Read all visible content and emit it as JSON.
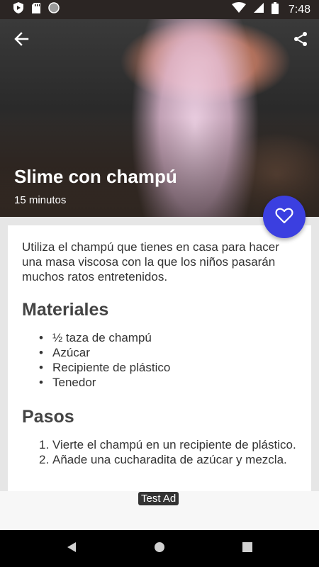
{
  "status_bar": {
    "time": "7:48",
    "icons": [
      "shield-icon",
      "sd-card-icon",
      "circle-icon",
      "wifi-icon",
      "signal-icon",
      "battery-icon"
    ]
  },
  "hero": {
    "title": "Slime con champú",
    "duration": "15 minutos",
    "back_icon": "arrow-back-icon",
    "share_icon": "share-icon"
  },
  "fab": {
    "icon": "heart-outline-icon",
    "color": "#3b3fe0"
  },
  "content": {
    "intro": "Utiliza el champú que tienes en casa para hacer una masa viscosa con la que los niños pasarán muchos ratos entretenidos.",
    "materials_title": "Materiales",
    "materials": [
      "½ taza de champú",
      "Azúcar",
      "Recipiente de plástico",
      "Tenedor"
    ],
    "steps_title": "Pasos",
    "steps": [
      {
        "num": "1.",
        "text": "Vierte el champú en un recipiente de plástico."
      },
      {
        "num": "2.",
        "text": "Añade una cucharadita de azúcar y mezcla."
      }
    ]
  },
  "ad": {
    "label": "Test Ad"
  },
  "nav": {
    "icons": [
      "back-triangle-icon",
      "home-circle-icon",
      "recents-square-icon"
    ]
  }
}
